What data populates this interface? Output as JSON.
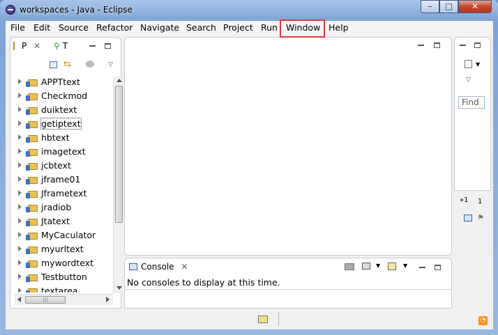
{
  "window": {
    "title": "workspaces - Java - Eclipse",
    "min": "–",
    "max": "□",
    "close": "✕"
  },
  "menu": [
    "File",
    "Edit",
    "Source",
    "Refactor",
    "Navigate",
    "Search",
    "Project",
    "Run",
    "Window",
    "Help"
  ],
  "package_explorer": {
    "tab1": "P",
    "tab2": "T",
    "projects": [
      "APPTtext",
      "Checkmod",
      "duiktext",
      "getiptext",
      "hbtext",
      "imagetext",
      "jcbtext",
      "jframe01",
      "Jframetext",
      "jradiob",
      "Jtatext",
      "MyCaculator",
      "myurltext",
      "mywordtext",
      "Testbutton",
      "textarea"
    ],
    "selected": "getiptext"
  },
  "console": {
    "tab": "Console",
    "message": "No consoles to display at this time."
  },
  "right_panel": {
    "find_placeholder": "Find",
    "overflow": "»1",
    "tab_label": "1"
  },
  "colors": {
    "highlight": "#e23b3b",
    "title_gradient_top": "#a8c4e8"
  }
}
